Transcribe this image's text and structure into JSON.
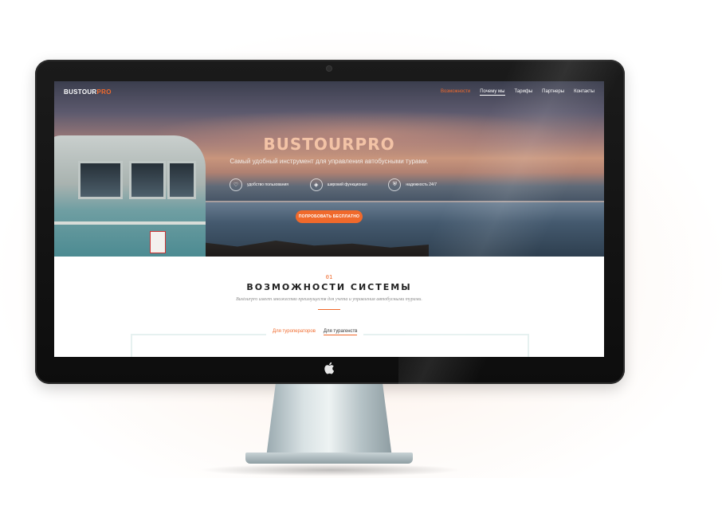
{
  "site": {
    "logo_main": "BUSTOUR",
    "logo_accent": "PRO",
    "menu": [
      {
        "label": "Возможности",
        "active": true
      },
      {
        "label": "Почему мы",
        "active": false
      },
      {
        "label": "Тарифы",
        "active": false
      },
      {
        "label": "Партнеры",
        "active": false
      },
      {
        "label": "Контакты",
        "active": false
      }
    ]
  },
  "hero": {
    "title": "BUSTOURPRO",
    "subtitle": "Самый удобный инструмент для управления автобусными турами.",
    "features": [
      {
        "icon": "heart-icon",
        "label": "удобство пользования"
      },
      {
        "icon": "layers-icon",
        "label": "широкий функционал"
      },
      {
        "icon": "shield-icon",
        "label": "надежность 24/7"
      }
    ],
    "cta_label": "ПОПРОБОВАТЬ БЕСПЛАТНО"
  },
  "section": {
    "number": "01",
    "title": "ВОЗМОЖНОСТИ СИСТЕМЫ",
    "description": "Bustourpro имеет множество преимуществ для учета и управления автобусными турами.",
    "tabs": [
      {
        "label": "Для туроператоров",
        "active": true
      },
      {
        "label": "Для турагенств",
        "active": false
      }
    ]
  },
  "colors": {
    "accent": "#f0692b",
    "title_peach": "#f3c3a6"
  }
}
